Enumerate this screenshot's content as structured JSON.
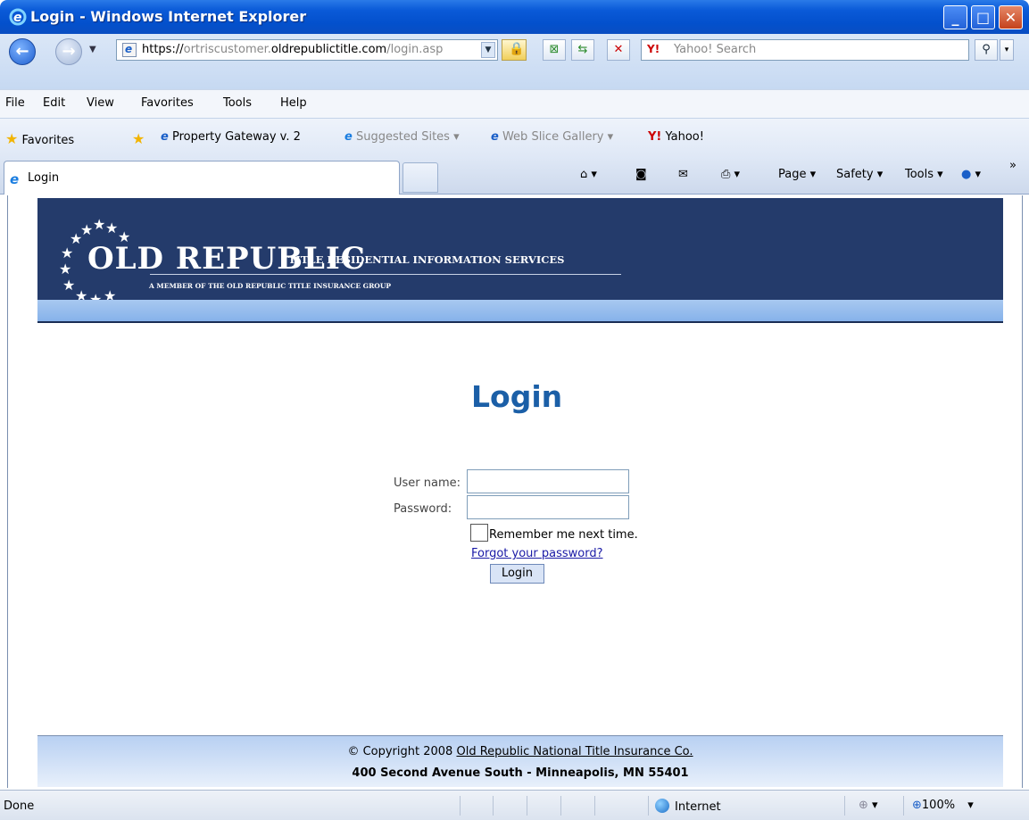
{
  "window": {
    "title": "Login - Windows Internet Explorer"
  },
  "address": {
    "url_prefix": "https://",
    "url_sub": "ortriscustomer.",
    "url_domain": "oldrepublictitle.com",
    "url_path": "/login.asp",
    "search_placeholder": "Yahoo! Search",
    "search_brand": "Y!"
  },
  "menu": [
    "File",
    "Edit",
    "View",
    "Favorites",
    "Tools",
    "Help"
  ],
  "favorites": {
    "label": "Favorites",
    "items": [
      "Property Gateway v. 2",
      "Suggested Sites ▾",
      "Web Slice Gallery ▾",
      "Yahoo!"
    ]
  },
  "tab": {
    "label": "Login"
  },
  "commands": {
    "page": "Page ▾",
    "safety": "Safety ▾",
    "tools": "Tools ▾",
    "chevron": "»"
  },
  "banner": {
    "title": "OLD REPUBLIC",
    "subtitle": "TITLE RESIDENTIAL INFORMATION SERVICES",
    "member": "A MEMBER OF THE OLD REPUBLIC TITLE INSURANCE GROUP"
  },
  "login": {
    "heading": "Login",
    "username_label": "User name:",
    "password_label": "Password:",
    "username_value": "",
    "password_value": "",
    "remember_label": "Remember me next time.",
    "forgot_link": "Forgot your password?",
    "submit": "Login"
  },
  "footer": {
    "copyright": "© Copyright 2008 ",
    "company_link": "Old Republic National Title Insurance Co.",
    "address": "400 Second Avenue South - Minneapolis, MN 55401"
  },
  "status": {
    "text": "Done",
    "zone": "Internet",
    "zoom": "100%"
  }
}
